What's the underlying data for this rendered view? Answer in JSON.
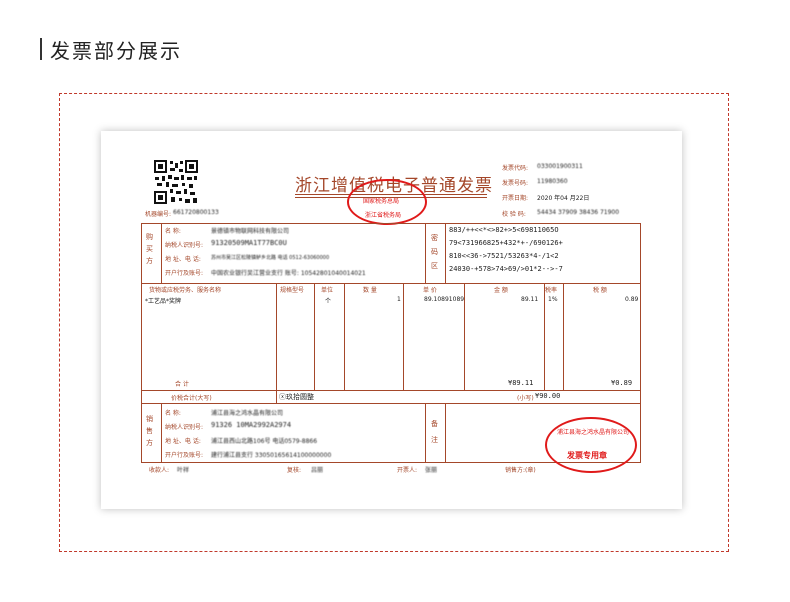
{
  "header": {
    "title": "发票部分展示"
  },
  "invoice": {
    "title": "浙江增值税电子普通发票",
    "right_info": {
      "code_label": "发票代码:",
      "code_value": "033001900311",
      "number_label": "发票号码:",
      "number_value": "11980360",
      "date_label": "开票日期:",
      "date_value": "2020 年04 月22日",
      "check_label": "校 验 码:",
      "check_value": "54434 37909 38436 71900"
    },
    "machine_label": "机器编号:",
    "machine_value": "661720800133",
    "buyer": {
      "side_label": "购买方",
      "name_label": "名    称:",
      "name_value": "景德镇市物联网科技有限公司",
      "tax_label": "纳税人识别号:",
      "tax_value": "91320509MA1T77BC0U",
      "addr_label": "地 址、电 话:",
      "addr_value": "苏州市吴江区松陵镇鲈乡北路 电话 0512-63060000",
      "bank_label": "开户行及账号:",
      "bank_value": "中国农业银行吴江营业支行 账号: 10542801040014021"
    },
    "cipher": {
      "side_label": "密码区",
      "lines": [
        "883/++<<*<>82+>5<69811065O",
        "79<731966825+432*+-/690126+",
        "810<<36->7521/53263*4-/1<2",
        "24030-+578>74>69/>01*2-->-7"
      ]
    },
    "items_header": {
      "name": "货物或应税劳务、服务名称",
      "spec": "规格型号",
      "unit": "单位",
      "qty": "数 量",
      "price": "单 价",
      "amount": "金 额",
      "rate": "税率",
      "tax": "税 额"
    },
    "items": [
      {
        "name": "*工艺品*奖牌",
        "spec": "",
        "unit": "个",
        "qty": "1",
        "price": "89.10891089",
        "amount": "89.11",
        "rate": "1%",
        "tax": "0.89"
      }
    ],
    "totals": {
      "label": "合    计",
      "amount": "¥89.11",
      "tax": "¥0.89"
    },
    "grand_total": {
      "label": "价税合计(大写)",
      "words": "ⓧ玖拾圆整",
      "small_label": "(小写)",
      "small_value": "¥90.00"
    },
    "seller": {
      "side_label": "销售方",
      "name_label": "名    称:",
      "name_value": "浦江县海之鸿水晶有限公司",
      "tax_label": "纳税人识别号:",
      "tax_value": "91326 10MA2992A2974",
      "addr_label": "地 址、电 话:",
      "addr_value": "浦江县西山北路106号 电话0579-8866",
      "bank_label": "开户行及账号:",
      "bank_value": "建行浦江县支行 33050165614100000000"
    },
    "remark": {
      "label": "备注"
    },
    "footer": {
      "payee_label": "收款人:",
      "payee_value": "叶祥",
      "review_label": "复核:",
      "review_value": "吕丽",
      "issuer_label": "开票人:",
      "issuer_value": "张丽",
      "seller_label": "销售方:(章)"
    },
    "stamps": {
      "top_small": "国家税务总局",
      "top_small2": "浙江省税务局",
      "seller_ring": "浦江县海之鸿水晶有限公司",
      "seller_label": "发票专用章"
    }
  },
  "colors": {
    "accent": "#a4472a",
    "stamp": "#e01a1a",
    "dashed": "#c0392b"
  }
}
